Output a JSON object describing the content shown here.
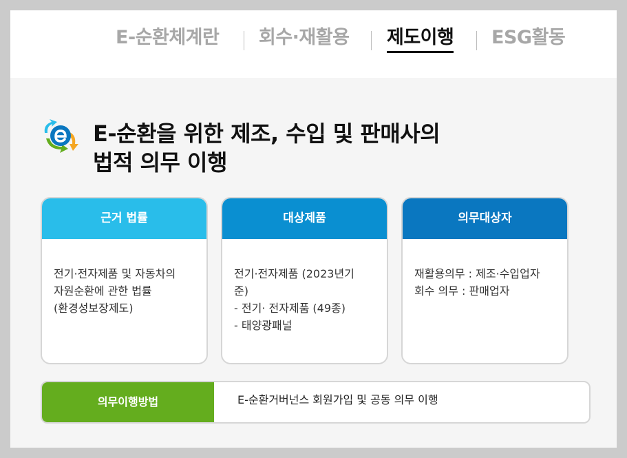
{
  "nav": {
    "tabs": [
      {
        "label": "E-순환체계란",
        "active": false
      },
      {
        "label": "회수·재활용",
        "active": false
      },
      {
        "label": "제도이행",
        "active": true
      },
      {
        "label": "ESG활동",
        "active": false
      }
    ]
  },
  "headline": {
    "line1": "E-순환을 위한 제조, 수입 및 판매사의",
    "line2": "법적 의무 이행"
  },
  "logo": {
    "icon": "e-circulation-logo-icon"
  },
  "cards": [
    {
      "title": "근거 법률",
      "lines": [
        "전기·전자제품 및 자동차의",
        "자원순환에 관한 법률",
        "(환경성보장제도)"
      ]
    },
    {
      "title": "대상제품",
      "lines": [
        "전기·전자제품 (2023년기",
        "준)",
        "- 전기· 전자제품 (49종)",
        "- 태양광패널"
      ]
    },
    {
      "title": "의무대상자",
      "lines": [
        "재활용의무 : 제조·수입업자",
        "회수 의무 : 판매업자"
      ]
    }
  ],
  "method": {
    "label": "의무이행방법",
    "text": "E-순환거버넌스 회원가입 및 공동 의무 이행"
  },
  "colors": {
    "card1_header": "#29bdea",
    "card2_header": "#0a8fd1",
    "card3_header": "#0a77c0",
    "method_label": "#64ad1e"
  }
}
